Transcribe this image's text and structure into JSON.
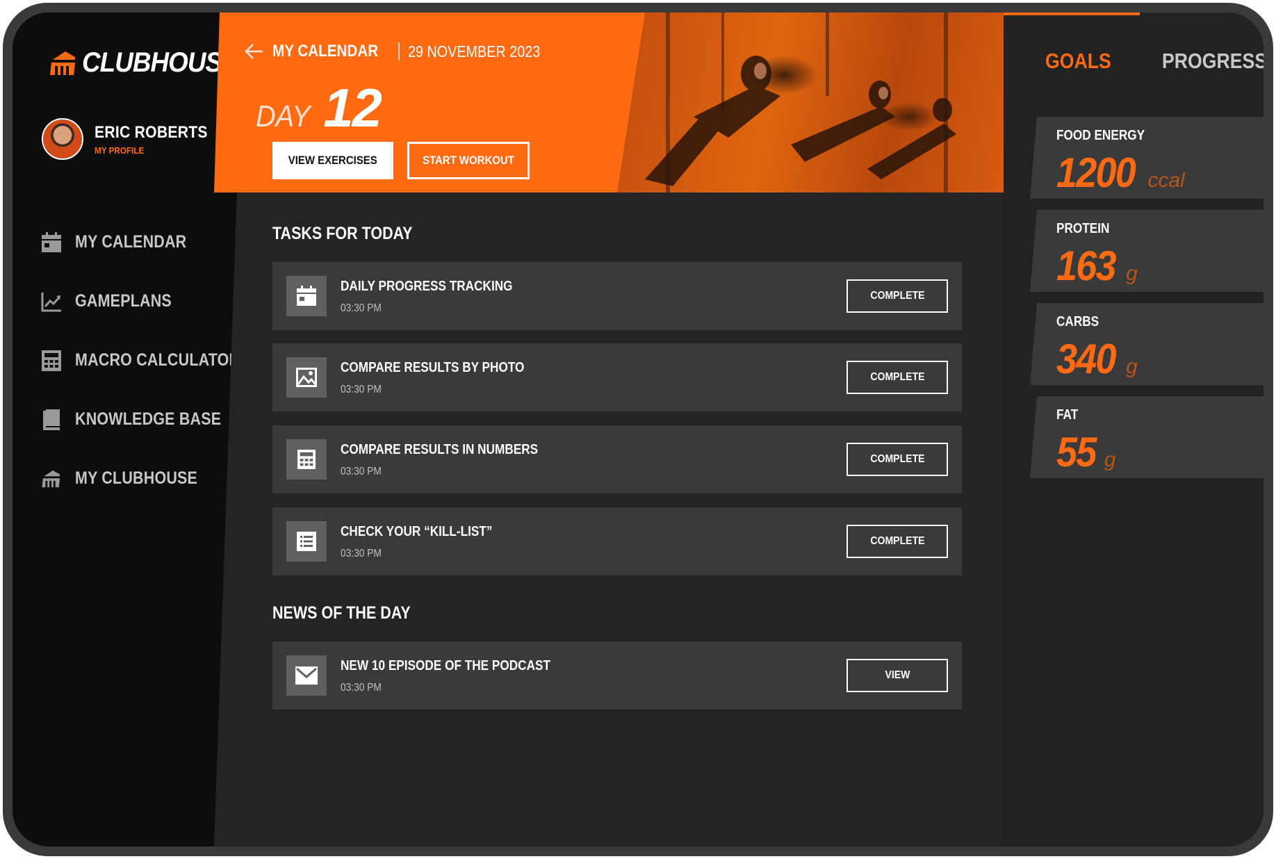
{
  "brand": {
    "name": "CLUBHOUSE",
    "accent": "#ff6a13"
  },
  "profile": {
    "name": "ERIC ROBERTS",
    "link": "MY PROFILE"
  },
  "nav": {
    "items": [
      {
        "label": "MY CALENDAR",
        "icon": "calendar-icon"
      },
      {
        "label": "GAMEPLANS",
        "icon": "chart-line-icon"
      },
      {
        "label": "MACRO CALCULATOR",
        "icon": "calculator-icon"
      },
      {
        "label": "KNOWLEDGE BASE",
        "icon": "book-icon"
      },
      {
        "label": "MY CLUBHOUSE",
        "icon": "clubhouse-icon"
      }
    ]
  },
  "header": {
    "title": "MY CALENDAR",
    "date": "29 NOVEMBER 2023",
    "day_word": "DAY",
    "day_number": "12",
    "view_exercises": "VIEW EXERCISES",
    "start_workout": "START WORKOUT"
  },
  "tasks": {
    "title": "TASKS FOR TODAY",
    "items": [
      {
        "title": "DAILY PROGRESS TRACKING",
        "time": "03:30 PM",
        "action": "COMPLETE",
        "icon": "calendar-icon"
      },
      {
        "title": "COMPARE RESULTS BY PHOTO",
        "time": "03:30 PM",
        "action": "COMPLETE",
        "icon": "image-icon"
      },
      {
        "title": "COMPARE RESULTS IN NUMBERS",
        "time": "03:30 PM",
        "action": "COMPLETE",
        "icon": "calculator-icon"
      },
      {
        "title": "CHECK YOUR “KILL-LIST”",
        "time": "03:30 PM",
        "action": "COMPLETE",
        "icon": "list-icon"
      }
    ]
  },
  "news": {
    "title": "NEWS OF THE DAY",
    "items": [
      {
        "title": "NEW  10 EPISODE OF THE PODCAST",
        "time": "03:30 PM",
        "action": "VIEW",
        "icon": "mail-icon"
      }
    ]
  },
  "right_panel": {
    "tabs": [
      "GOALS",
      "PROGRESS"
    ],
    "active_tab": "GOALS",
    "macros": [
      {
        "label": "FOOD ENERGY",
        "value": "1200",
        "unit": "ccal"
      },
      {
        "label": "PROTEIN",
        "value": "163",
        "unit": "g"
      },
      {
        "label": "CARBS",
        "value": "340",
        "unit": "g"
      },
      {
        "label": "FAT",
        "value": "55",
        "unit": "g"
      }
    ]
  }
}
